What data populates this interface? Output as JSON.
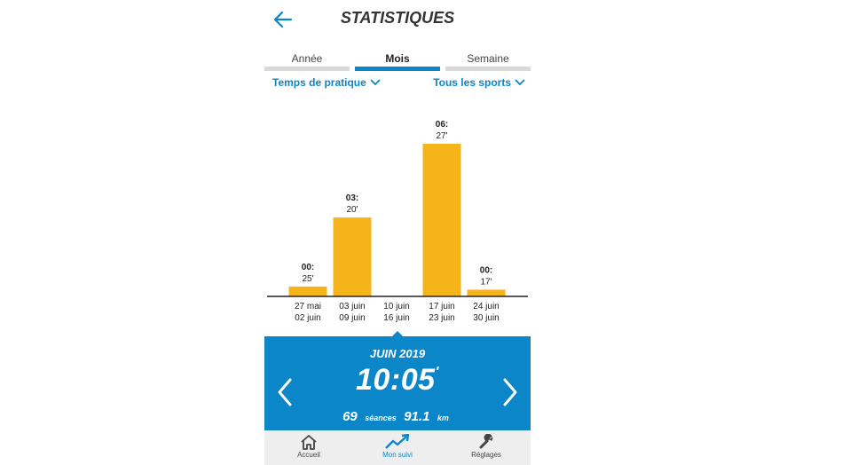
{
  "header": {
    "title": "STATISTIQUES",
    "back_icon": "arrow-left-icon"
  },
  "tabs": [
    {
      "label": "Année",
      "active": false
    },
    {
      "label": "Mois",
      "active": true
    },
    {
      "label": "Semaine",
      "active": false
    }
  ],
  "filters": {
    "metric": "Temps de pratique",
    "sport": "Tous les sports"
  },
  "chart_data": {
    "type": "bar",
    "categories": [
      [
        "27 mai",
        "02 juin"
      ],
      [
        "03 juin",
        "09 juin"
      ],
      [
        "10 juin",
        "16 juin"
      ],
      [
        "17 juin",
        "23 juin"
      ],
      [
        "24 juin",
        "30 juin"
      ]
    ],
    "values_minutes": [
      25,
      200,
      0,
      387,
      17
    ],
    "labels": [
      [
        "00:",
        "25'"
      ],
      [
        "03:",
        "20'"
      ],
      null,
      [
        "06:",
        "27'"
      ],
      [
        "00:",
        "17'"
      ]
    ],
    "bar_color": "#f5b41a"
  },
  "summary": {
    "month": "JUIN 2019",
    "time_main": "10:05",
    "time_suffix": "'",
    "sessions": "69",
    "sessions_label": "séances",
    "distance": "91.1",
    "distance_unit": "km",
    "background": "#0b86c8"
  },
  "bottom_nav": [
    {
      "label": "Accueil",
      "icon": "home-icon",
      "active": false
    },
    {
      "label": "Mon suivi",
      "icon": "trend-up-icon",
      "active": true
    },
    {
      "label": "Réglages",
      "icon": "wrench-icon",
      "active": false
    }
  ]
}
